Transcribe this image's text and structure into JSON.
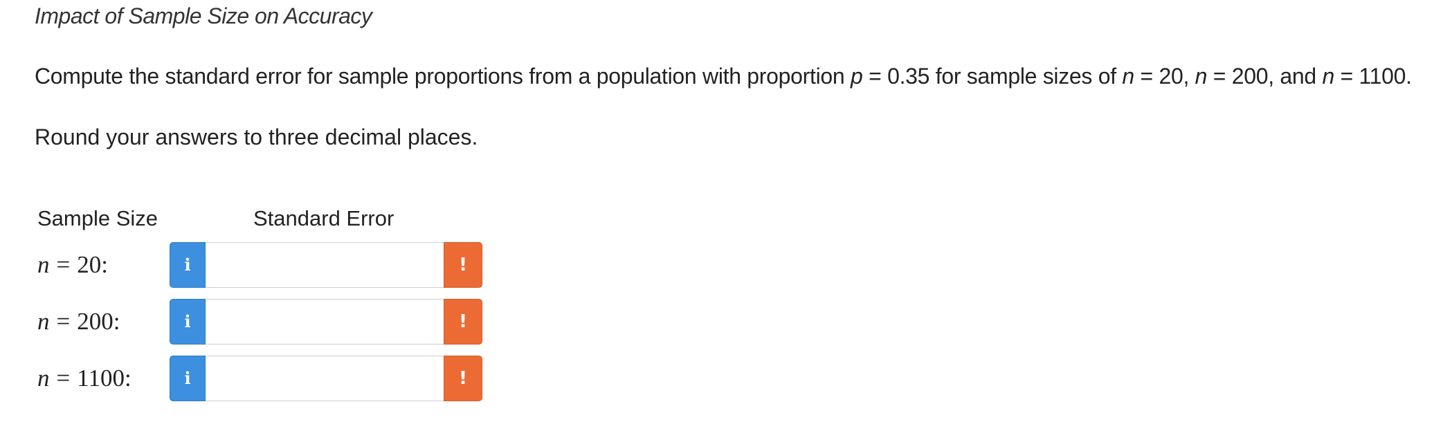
{
  "title": "Impact of Sample Size on Accuracy",
  "prompt": {
    "text_1": "Compute the standard error for sample proportions from a population with proportion ",
    "p_var": "p",
    "text_2": " = 0.35 for sample sizes of ",
    "n_var_1": "n",
    "text_3": " = 20, ",
    "n_var_2": "n",
    "text_4": " = 200, and ",
    "n_var_3": "n",
    "text_5": " = 1100."
  },
  "instruction": "Round your answers to three decimal places.",
  "columns": {
    "sample_size": "Sample Size",
    "standard_error": "Standard Error"
  },
  "rows": [
    {
      "var": "n",
      "eq": "=",
      "value": "20:",
      "info_icon": "i",
      "warn_icon": "!",
      "input_value": ""
    },
    {
      "var": "n",
      "eq": "=",
      "value": "200:",
      "info_icon": "i",
      "warn_icon": "!",
      "input_value": ""
    },
    {
      "var": "n",
      "eq": "=",
      "value": "1100:",
      "info_icon": "i",
      "warn_icon": "!",
      "input_value": ""
    }
  ],
  "colors": {
    "info_button": "#3d8fe0",
    "warning_button": "#ec6b35"
  }
}
